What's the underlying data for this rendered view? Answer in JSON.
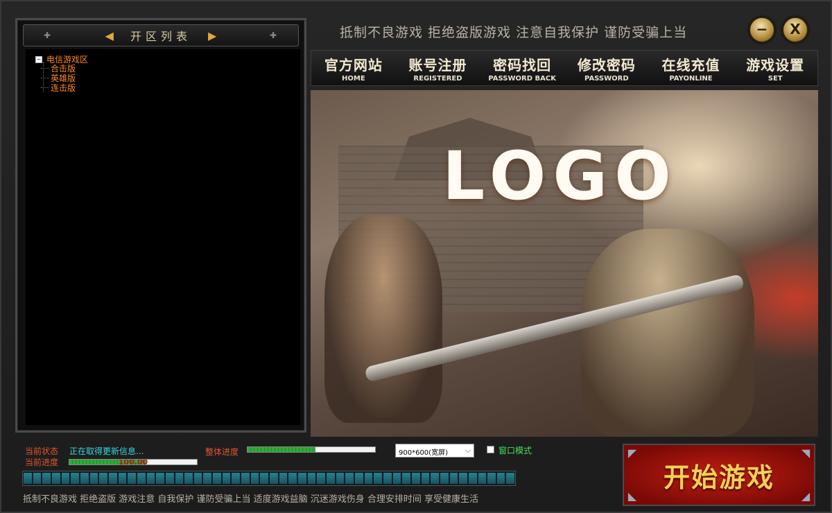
{
  "server_list": {
    "title": "开区列表",
    "root": "电信游戏区",
    "children": [
      "合击版",
      "英雄版",
      "连击版"
    ]
  },
  "slogan": "抵制不良游戏  拒绝盗版游戏  注意自我保护  谨防受骗上当",
  "window": {
    "minimize": "−",
    "close": "X"
  },
  "nav": [
    {
      "cn": "官方网站",
      "en": "HOME"
    },
    {
      "cn": "账号注册",
      "en": "REGISTERED"
    },
    {
      "cn": "密码找回",
      "en": "PASSWORD BACK"
    },
    {
      "cn": "修改密码",
      "en": "PASSWORD"
    },
    {
      "cn": "在线充值",
      "en": "PAYONLINE"
    },
    {
      "cn": "游戏设置",
      "en": "SET"
    }
  ],
  "banner": {
    "logo": "LOGO"
  },
  "status": {
    "current_status_label": "当前状态",
    "current_status_value": "正在取得更新信息...",
    "current_progress_label": "当前进度",
    "current_progress_text": "100.00",
    "current_progress_value": 0.6,
    "overall_progress_label": "整体进度",
    "overall_progress_value": 0.53
  },
  "resolution": {
    "selected": "900*600(宽屏)"
  },
  "window_mode": {
    "label": "窗口模式",
    "checked": false
  },
  "footer": "抵制不良游戏  拒绝盗版  游戏注意  自我保护  谨防受骗上当  适度游戏益脑  沉迷游戏伤身  合理安排时间  享受健康生活",
  "start_button": "开始游戏",
  "colors": {
    "status_label": "#e0552e",
    "status_value": "#38d6e0",
    "window_mode": "#45e64d",
    "start_text": "#f7cf56"
  }
}
